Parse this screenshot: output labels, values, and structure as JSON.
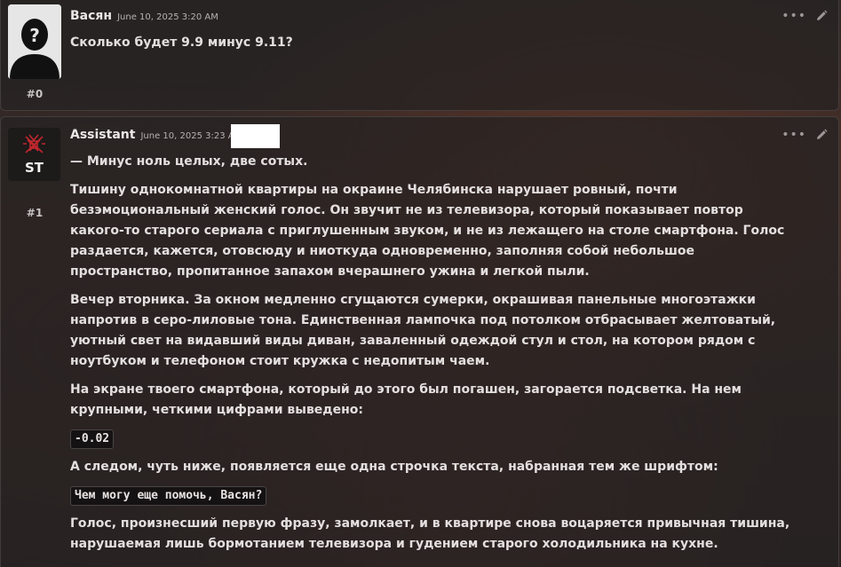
{
  "posts": [
    {
      "author": "Васян",
      "date": "June 10, 2025 3:20 AM",
      "number": "#0",
      "text": "Сколько будет 9.9 минус 9.11?"
    },
    {
      "author": "Assistant",
      "date": "June 10, 2025 3:23 AM",
      "number": "#1",
      "avatar_text": "ST",
      "paragraphs": [
        "— Минус ноль целых, две сотых.",
        "Тишину однокомнатной квартиры на окраине Челябинска нарушает ровный, почти безэмоциональный женский голос. Он звучит не из телевизора, который показывает повтор какого-то старого сериала с приглушенным звуком, и не из лежащего на столе смартфона. Голос раздается, кажется, отовсюду и ниоткуда одновременно, заполняя собой небольшое пространство, пропитанное запахом вчерашнего ужина и легкой пыли.",
        "Вечер вторника. За окном медленно сгущаются сумерки, окрашивая панельные многоэтажки напротив в серо-лиловые тона. Единственная лампочка под потолком отбрасывает желтоватый, уютный свет на видавший виды диван, заваленный одеждой стул и стол, на котором рядом с ноутбуком и телефоном стоит кружка с недопитым чаем.",
        "На экране твоего смартфона, который до этого был погашен, загорается подсветка. На нем крупными, четкими цифрами выведено:",
        "-0.02",
        "А следом, чуть ниже, появляется еще одна строчка текста, набранная тем же шрифтом:",
        "Чем могу еще помочь, Васян?",
        "Голос, произнесший первую фразу, замолкает, и в квартире снова воцаряется привычная тишина, нарушаемая лишь бормотанием телевизора и гудением старого холодильника на кухне."
      ]
    }
  ],
  "icons": {
    "more": "ellipsis-icon",
    "edit": "pencil-icon"
  },
  "colors": {
    "post_bg": "#262222",
    "text": "#e4dfdf",
    "avatar_accent": "#c0272d"
  }
}
